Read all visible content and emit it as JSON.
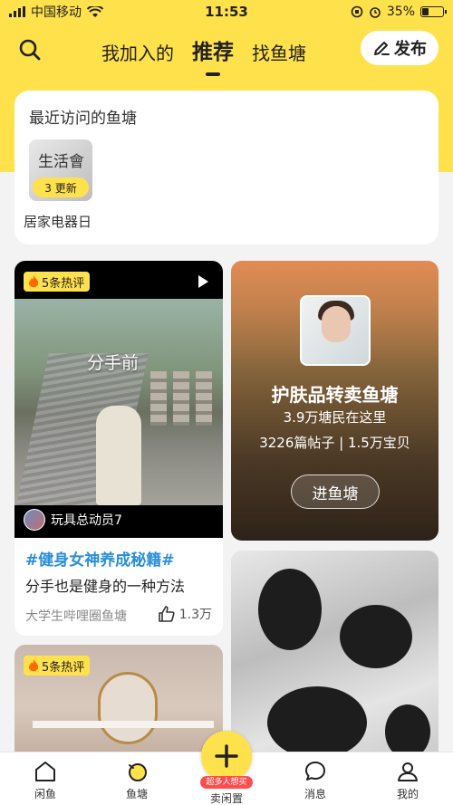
{
  "status_bar": {
    "carrier": "中国移动",
    "time": "11:53",
    "battery": "35%",
    "battery_level": 0.35
  },
  "top_nav": {
    "tabs": [
      {
        "label": "我加入的"
      },
      {
        "label": "推荐"
      },
      {
        "label": "找鱼塘"
      }
    ],
    "active_tab": 1,
    "publish_label": "发布"
  },
  "recent": {
    "title": "最近访问的鱼塘",
    "items": [
      {
        "thumb_text": "生活會",
        "badge": "3 更新",
        "label": "居家电器日"
      }
    ]
  },
  "feed": {
    "video_card": {
      "hot_badge": "5条热评",
      "overlay_caption": "分手前",
      "author": "玩具总动员7",
      "tag": "#健身女神养成秘籍#",
      "description": "分手也是健身的一种方法",
      "pond": "大学生哔哩圈鱼塘",
      "likes": "1.3万"
    },
    "pond_card": {
      "name": "护肤品转卖鱼塘",
      "members": "3.9万塘民在这里",
      "stats": "3226篇帖子 | 1.5万宝贝",
      "enter_label": "进鱼塘"
    },
    "room_card": {
      "hot_badge": "5条热评"
    }
  },
  "tab_bar": {
    "items": [
      {
        "label": "闲鱼"
      },
      {
        "label": "鱼塘"
      },
      {
        "label": "卖闲置",
        "tag": "超多人想买"
      },
      {
        "label": "消息"
      },
      {
        "label": "我的"
      }
    ]
  },
  "colors": {
    "brand_yellow": "#ffe14b",
    "tag_blue": "#2a8fd8",
    "hot_red": "#ff4d4f"
  }
}
